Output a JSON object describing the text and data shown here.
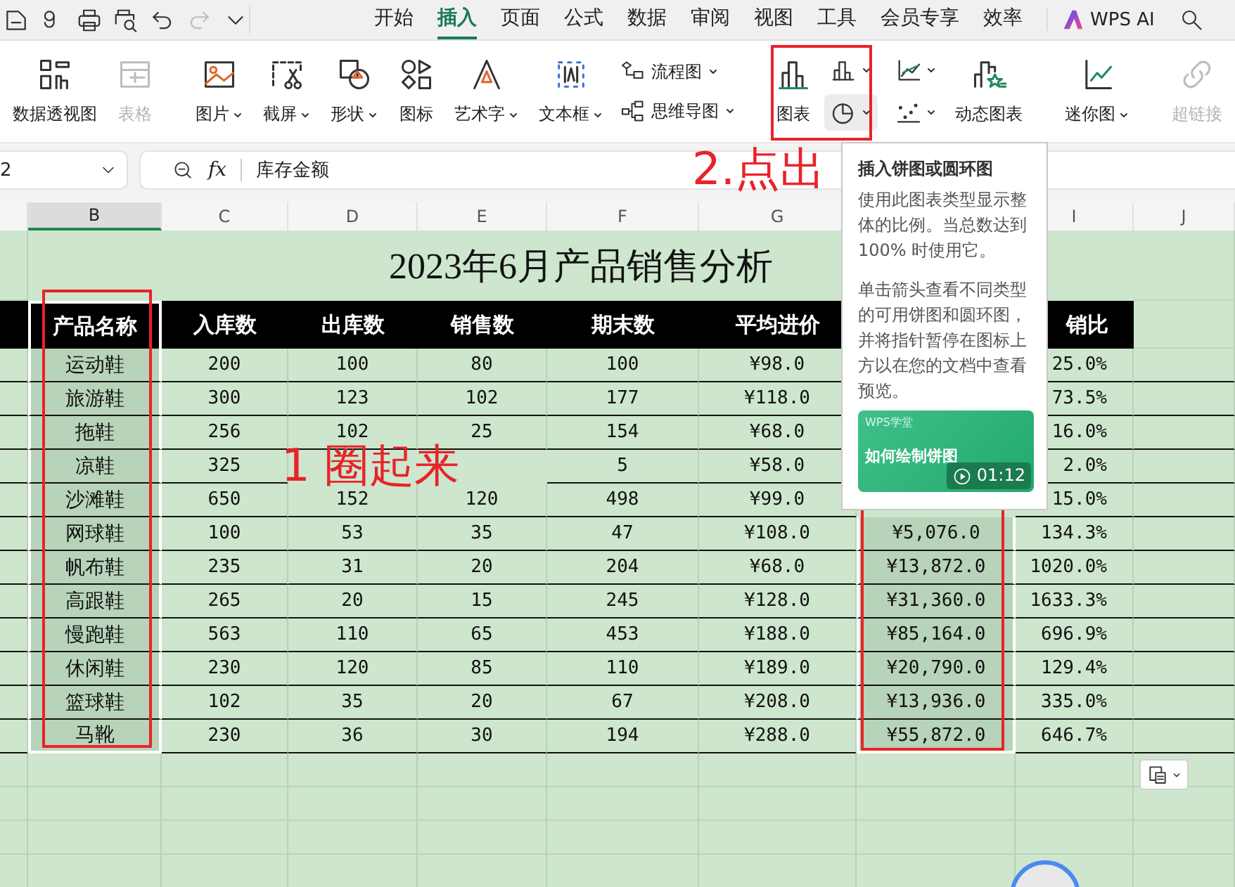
{
  "quick_tools": [
    {
      "kind": "document",
      "disabled": false
    },
    {
      "kind": "curl",
      "disabled": false
    },
    {
      "kind": "print",
      "disabled": false
    },
    {
      "kind": "preview",
      "disabled": false
    },
    {
      "kind": "undo",
      "disabled": false
    },
    {
      "kind": "redo",
      "disabled": true
    },
    {
      "kind": "more",
      "disabled": false
    }
  ],
  "menu": [
    {
      "label": "开始",
      "selected": false
    },
    {
      "label": "插入",
      "selected": true
    },
    {
      "label": "页面",
      "selected": false
    },
    {
      "label": "公式",
      "selected": false
    },
    {
      "label": "数据",
      "selected": false
    },
    {
      "label": "审阅",
      "selected": false
    },
    {
      "label": "视图",
      "selected": false
    },
    {
      "label": "工具",
      "selected": false
    },
    {
      "label": "会员专享",
      "selected": false
    },
    {
      "label": "效率",
      "selected": false
    }
  ],
  "ai_button": "WPS AI",
  "ribbon": [
    [
      {
        "kind": "pivot",
        "label": "数据透视图",
        "dropdown": false,
        "disabled": false
      },
      {
        "kind": "table",
        "label": "表格",
        "dropdown": false,
        "disabled": true
      }
    ],
    [
      {
        "kind": "picture",
        "label": "图片",
        "dropdown": true,
        "disabled": false
      },
      {
        "kind": "screenshot",
        "label": "截屏",
        "dropdown": true,
        "disabled": false
      },
      {
        "kind": "shape",
        "label": "形状",
        "dropdown": true,
        "disabled": false
      },
      {
        "kind": "icons",
        "label": "图标",
        "dropdown": false,
        "disabled": false
      },
      {
        "kind": "wordart",
        "label": "艺术字",
        "dropdown": true,
        "disabled": false
      },
      {
        "kind": "textbox",
        "label": "文本框",
        "dropdown": true,
        "disabled": false
      },
      {
        "kind": "stack",
        "items": [
          {
            "kind": "flowchart",
            "label": "流程图",
            "dropdown": true
          },
          {
            "kind": "mindmap",
            "label": "思维导图",
            "dropdown": true
          }
        ]
      }
    ],
    [
      {
        "kind": "chart",
        "label": "图表",
        "dropdown": false,
        "disabled": false
      },
      {
        "kind": "grid",
        "items": [
          {
            "kind": "bar",
            "dropdown": true,
            "selected": false
          },
          {
            "kind": "line",
            "dropdown": true,
            "selected": false
          },
          {
            "kind": "pie",
            "dropdown": true,
            "selected": true
          },
          {
            "kind": "scatter",
            "dropdown": true,
            "selected": false
          }
        ]
      },
      {
        "kind": "dynamic",
        "label": "动态图表",
        "dropdown": false,
        "disabled": false
      }
    ],
    [
      {
        "kind": "sparkline",
        "label": "迷你图",
        "dropdown": true,
        "disabled": false
      }
    ],
    [
      {
        "kind": "hyperlink",
        "label": "超链接",
        "dropdown": false,
        "disabled": true
      }
    ]
  ],
  "formula_bar": {
    "name_box": "2",
    "function_label": "fx",
    "value": "库存金额"
  },
  "sheet": {
    "title": "2023年6月产品销售分析",
    "columns": [
      {
        "letter": "B",
        "header": "产品名称",
        "selected": true
      },
      {
        "letter": "C",
        "header": "入库数",
        "selected": false
      },
      {
        "letter": "D",
        "header": "出库数",
        "selected": false
      },
      {
        "letter": "E",
        "header": "销售数",
        "selected": false
      },
      {
        "letter": "F",
        "header": "期末数",
        "selected": false
      },
      {
        "letter": "G",
        "header": "平均进价",
        "selected": false
      },
      {
        "selected": true
      },
      {
        "letter": "I",
        "header": "销比",
        "selected": false
      },
      {
        "letter": "J",
        "selected": false
      }
    ],
    "rows": [
      [
        "运动鞋",
        "200",
        "100",
        "80",
        "100",
        "¥98.0",
        null,
        "25.0%"
      ],
      [
        "旅游鞋",
        "300",
        "123",
        "102",
        "177",
        "¥118.0",
        null,
        "73.5%"
      ],
      [
        "拖鞋",
        "256",
        "102",
        "25",
        "154",
        "¥68.0",
        null,
        "16.0%"
      ],
      [
        "凉鞋",
        "325",
        null,
        null,
        "5",
        "¥58.0",
        null,
        "2.0%"
      ],
      [
        "沙滩鞋",
        "650",
        "152",
        "120",
        "498",
        "¥99.0",
        null,
        "15.0%"
      ],
      [
        "网球鞋",
        "100",
        "53",
        "35",
        "47",
        "¥108.0",
        "¥5,076.0",
        "134.3%"
      ],
      [
        "帆布鞋",
        "235",
        "31",
        "20",
        "204",
        "¥68.0",
        "¥13,872.0",
        "1020.0%"
      ],
      [
        "高跟鞋",
        "265",
        "20",
        "15",
        "245",
        "¥128.0",
        "¥31,360.0",
        "1633.3%"
      ],
      [
        "慢跑鞋",
        "563",
        "110",
        "65",
        "453",
        "¥188.0",
        "¥85,164.0",
        "696.9%"
      ],
      [
        "休闲鞋",
        "230",
        "120",
        "85",
        "110",
        "¥189.0",
        "¥20,790.0",
        "129.4%"
      ],
      [
        "篮球鞋",
        "102",
        "35",
        "20",
        "67",
        "¥208.0",
        "¥13,936.0",
        "335.0%"
      ],
      [
        "马靴",
        "230",
        "36",
        "30",
        "194",
        "¥288.0",
        "¥55,872.0",
        "646.7%"
      ]
    ]
  },
  "tooltip": {
    "title": "插入饼图或圆环图",
    "paragraphs": [
      "使用此图表类型显示整体的比例。当总数达到 100% 时使用它。",
      "单击箭头查看不同类型的可用饼图和圆环图，并将指针暂停在图标上方以在您的文档中查看预览。"
    ],
    "video": {
      "brand": "WPS学堂",
      "title": "如何绘制饼图",
      "duration": "01:12"
    }
  },
  "annotations": {
    "step1": "1 圈起来",
    "step2": "2.点出"
  }
}
